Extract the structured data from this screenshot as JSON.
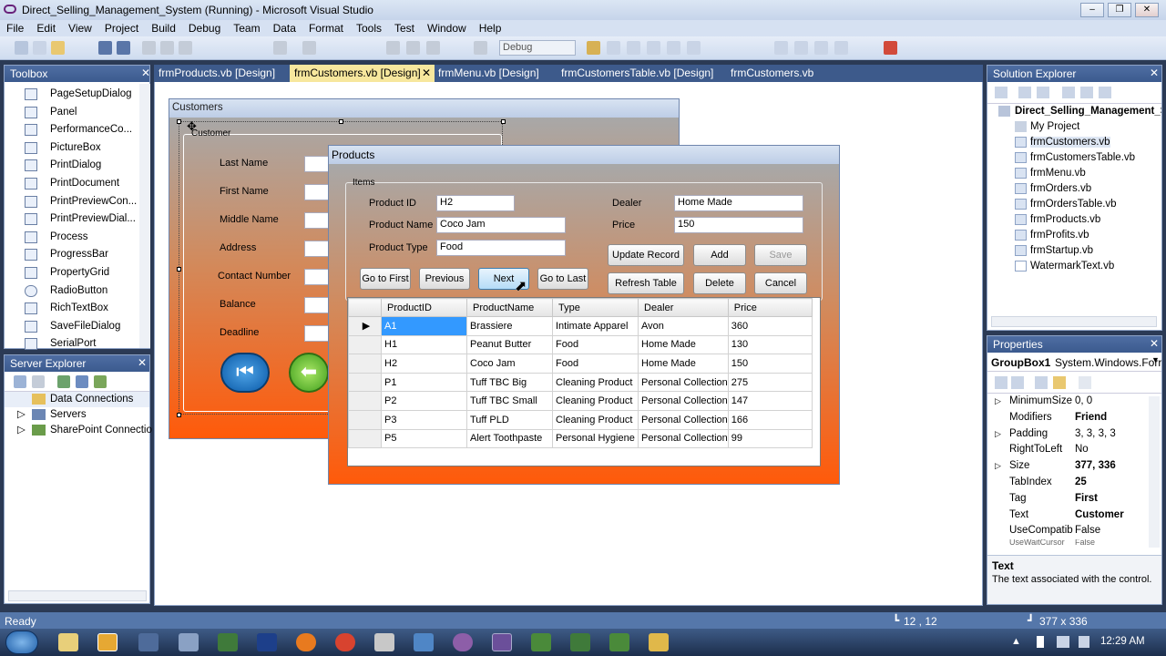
{
  "window": {
    "title": "Direct_Selling_Management_System (Running) - Microsoft Visual Studio",
    "min": "0",
    "max": "1",
    "close": "r"
  },
  "menu": [
    "File",
    "Edit",
    "View",
    "Project",
    "Build",
    "Debug",
    "Team",
    "Data",
    "Format",
    "Tools",
    "Test",
    "Window",
    "Help"
  ],
  "toolbar": {
    "config": "Debug"
  },
  "toolbox": {
    "title": "Toolbox",
    "items": [
      "PageSetupDialog",
      "Panel",
      "PerformanceCo...",
      "PictureBox",
      "PrintDialog",
      "PrintDocument",
      "PrintPreviewCon...",
      "PrintPreviewDial...",
      "Process",
      "ProgressBar",
      "PropertyGrid",
      "RadioButton",
      "RichTextBox",
      "SaveFileDialog",
      "SerialPort"
    ]
  },
  "server_explorer": {
    "title": "Server Explorer",
    "items": [
      "Data Connections",
      "Servers",
      "SharePoint Connectio"
    ]
  },
  "tabs": [
    "frmProducts.vb [Design]",
    "frmCustomers.vb [Design]",
    "frmMenu.vb [Design]",
    "frmCustomersTable.vb [Design]",
    "frmCustomers.vb"
  ],
  "customers_form": {
    "title": "Customers",
    "group": "Customer",
    "labels": [
      "Last Name",
      "First Name",
      "Middle Name",
      "Address",
      "Contact Number",
      "Balance",
      "Deadline"
    ]
  },
  "products_form": {
    "title": "Products",
    "group": "Items",
    "product_id_label": "Product ID",
    "product_id": "H2",
    "product_name_label": "Product Name",
    "product_name": "Coco Jam",
    "product_type_label": "Product Type",
    "product_type": "Food",
    "dealer_label": "Dealer",
    "dealer": "Home Made",
    "price_label": "Price",
    "price": "150",
    "buttons": {
      "first": "Go to First",
      "previous": "Previous",
      "next": "Next",
      "last": "Go to Last",
      "update": "Update Record",
      "add": "Add",
      "save": "Save",
      "refresh": "Refresh Table",
      "delete": "Delete",
      "cancel": "Cancel"
    },
    "grid": {
      "columns": [
        "ProductID",
        "ProductName",
        "Type",
        "Dealer",
        "Price"
      ],
      "rows": [
        [
          "A1",
          "Brassiere",
          "Intimate Apparel",
          "Avon",
          "360"
        ],
        [
          "H1",
          "Peanut Butter",
          "Food",
          "Home Made",
          "130"
        ],
        [
          "H2",
          "Coco Jam",
          "Food",
          "Home Made",
          "150"
        ],
        [
          "P1",
          "Tuff TBC Big",
          "Cleaning Product",
          "Personal Collection",
          "275"
        ],
        [
          "P2",
          "Tuff TBC Small",
          "Cleaning Product",
          "Personal Collection",
          "147"
        ],
        [
          "P3",
          "Tuff PLD",
          "Cleaning Product",
          "Personal Collection",
          "166"
        ],
        [
          "P5",
          "Alert Toothpaste",
          "Personal Hygiene",
          "Personal Collection",
          "99"
        ]
      ]
    }
  },
  "solution_explorer": {
    "title": "Solution Explorer",
    "project": "Direct_Selling_Management_Sy",
    "items": [
      "My Project",
      "frmCustomers.vb",
      "frmCustomersTable.vb",
      "frmMenu.vb",
      "frmOrders.vb",
      "frmOrdersTable.vb",
      "frmProducts.vb",
      "frmProfits.vb",
      "frmStartup.vb",
      "WatermarkText.vb"
    ]
  },
  "properties": {
    "title": "Properties",
    "object": "GroupBox1",
    "object_type": "System.Windows.Forr",
    "rows": [
      {
        "n": "MinimumSize",
        "v": "0, 0"
      },
      {
        "n": "Modifiers",
        "v": "Friend"
      },
      {
        "n": "Padding",
        "v": "3, 3, 3, 3"
      },
      {
        "n": "RightToLeft",
        "v": "No"
      },
      {
        "n": "Size",
        "v": "377, 336"
      },
      {
        "n": "TabIndex",
        "v": "25"
      },
      {
        "n": "Tag",
        "v": "First"
      },
      {
        "n": "Text",
        "v": "Customer"
      },
      {
        "n": "UseCompatib",
        "v": "False"
      },
      {
        "n": "UseWaitCursor",
        "v": "False"
      }
    ],
    "desc_title": "Text",
    "desc": "The text associated with the control."
  },
  "status": {
    "text": "Ready",
    "position": "12 , 12",
    "size": "377 x 336"
  },
  "clock": "12:29 AM"
}
